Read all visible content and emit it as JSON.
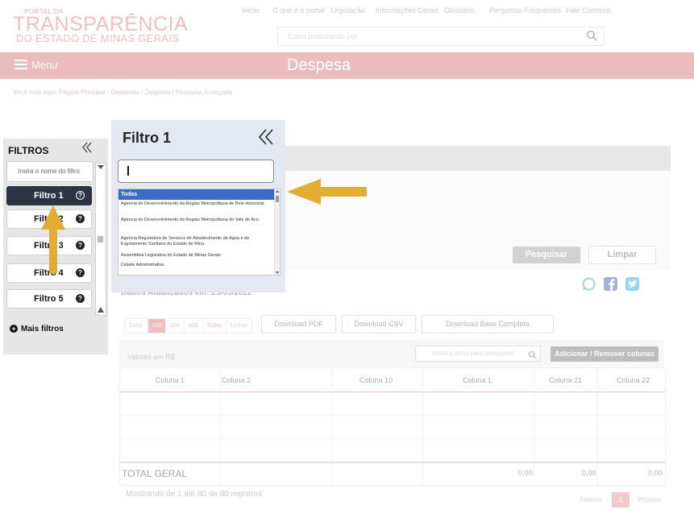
{
  "header": {
    "logo_small": "PORTAL DA",
    "logo_big": "TRANSPARÊNCIA",
    "logo_sub": "DO ESTADO DE MINAS GERAIS",
    "nav": [
      "Início",
      "O que é o portal",
      "Legislação",
      "Informações Gerais",
      "Glossário",
      "Perguntas Frequentes",
      "Fale Conosco"
    ],
    "search_placeholder": "Estou procurando por"
  },
  "menu": {
    "label": "Menu",
    "page_title": "Despesa"
  },
  "breadcrumb": {
    "prefix": "Você está aqui:",
    "items": [
      "Página Principal",
      "Despesas",
      "Despesa",
      "Pesquisa Avançada"
    ]
  },
  "sidebar": {
    "title": "FILTROS",
    "search_placeholder": "Insira o nome do filtro",
    "filters": [
      "Filtro 1",
      "Filtro 2",
      "Filtro 3",
      "Filtro 4",
      "Filtro 5"
    ],
    "more": "Mais filtros"
  },
  "filter_panel": {
    "title": "Filtro 1",
    "input_value": "",
    "options": [
      "Todas",
      "Agencia de Desenvolvimento da Regiao Metropolitana de Belo Horizonte",
      "Agencia de Desenvolvimento da Regiao Metropolitana do Vale do Aco",
      "Agencia Reguladora de Servicos de Abastecimento de Agua e de Esgotamento Sanitario do Estado de Mina",
      "Assembleia Legislativa do Estado de Minas Gerais",
      "Cidade Administrativa"
    ]
  },
  "content": {
    "pesquisar": "Pesquisar",
    "limpar": "Limpar",
    "updated": "Dados Atualizados em: 25/05/2022",
    "row_options": [
      "Exibir",
      "100",
      "250",
      "500",
      "Todas",
      "Linhas"
    ],
    "download_pdf": "Download PDF",
    "download_csv": "Download CSV",
    "download_full": "Download Base Completa",
    "valores": "Valores em R$",
    "table_search_placeholder": "Insira o texto para pesquisar",
    "add_remove": "Adicionar / Remover colunas",
    "columns": [
      "Coluna 1",
      "Coluna 2",
      "Coluna 10",
      "Coluna 1",
      "Coluna 21",
      "Coluna 22"
    ],
    "total_label": "TOTAL GERAL",
    "totals": [
      "0,00",
      "0,00",
      "0,00"
    ],
    "showing": "Mostrando de 1 até 80 de 80 registros",
    "prev": "Anterior",
    "page": "1",
    "next": "Próximo"
  },
  "colors": {
    "accent": "#d9706e",
    "menu_bar": "#ebbcbc",
    "active_filter": "#2c3444",
    "highlight": "#3d6cc4",
    "arrow": "#e2ad32"
  }
}
